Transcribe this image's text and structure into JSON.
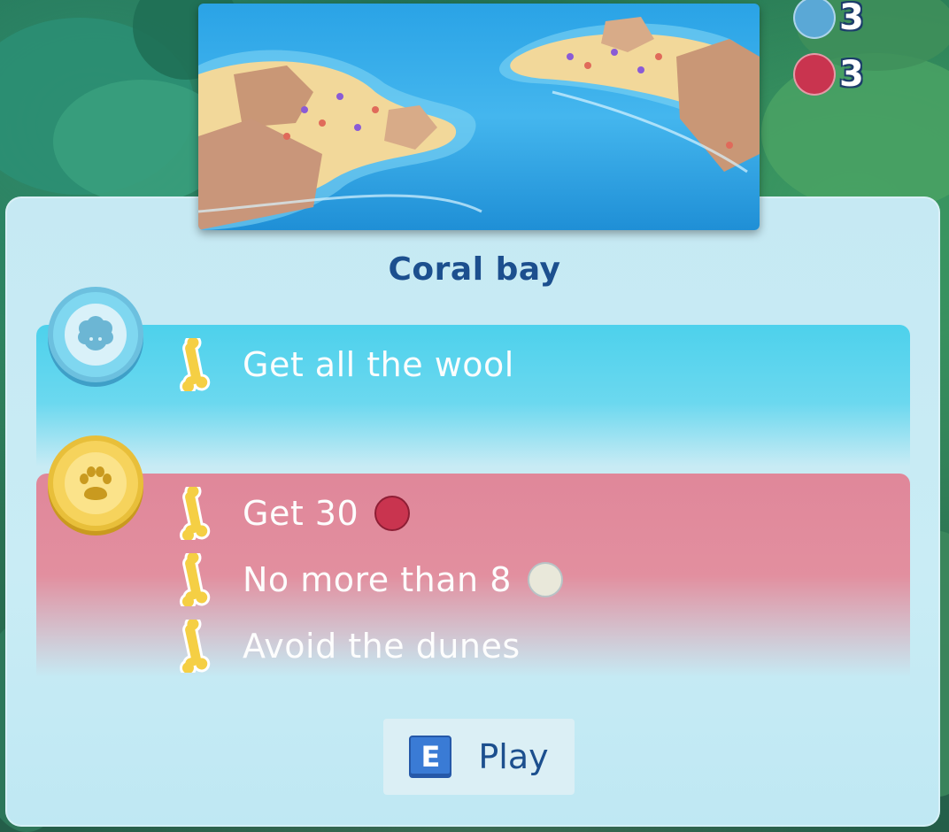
{
  "hud": {
    "counters": [
      {
        "icon": "blue-orb-icon",
        "color": "#5aa8d6",
        "value": "3"
      },
      {
        "icon": "red-orb-icon",
        "color": "#c9344f",
        "value": "3"
      }
    ]
  },
  "level": {
    "title": "Coral bay",
    "preview_icon": "island-map-preview"
  },
  "objectives": {
    "primary": {
      "badge_icon": "sheep-icon",
      "items": [
        {
          "icon": "bone-icon",
          "text": "Get all the wool"
        }
      ]
    },
    "bonus": {
      "badge_icon": "paw-icon",
      "items": [
        {
          "icon": "bone-icon",
          "text": "Get 30",
          "chip": "red"
        },
        {
          "icon": "bone-icon",
          "text": "No more than 8",
          "chip": "white"
        },
        {
          "icon": "bone-icon",
          "text": "Avoid the dunes"
        }
      ]
    }
  },
  "play_button": {
    "key": "E",
    "label": "Play"
  },
  "colors": {
    "title": "#1c4f8e",
    "primary_band": "#4dd1ec",
    "bonus_band": "#e0879a",
    "chip_red": "#c9344f",
    "chip_white": "#e9e8da"
  }
}
